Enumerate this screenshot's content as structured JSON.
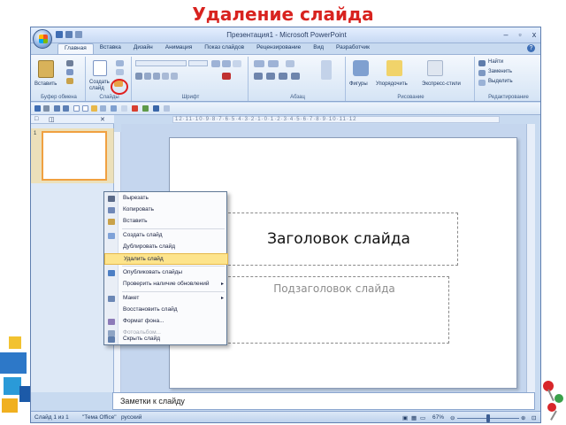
{
  "heading": "Удаление слайда",
  "window": {
    "title": "Презентация1 - Microsoft PowerPoint",
    "controls": [
      "–",
      "▫",
      "x"
    ]
  },
  "ribbon": {
    "tabs": [
      "Главная",
      "Вставка",
      "Дизайн",
      "Анимация",
      "Показ слайдов",
      "Рецензирование",
      "Вид",
      "Разработчик"
    ],
    "groups": {
      "clipboard": {
        "label": "Буфер обмена",
        "paste": "Вставить"
      },
      "slides": {
        "label": "Слайды",
        "new_slide": "Создать слайд"
      },
      "font": {
        "label": "Шрифт"
      },
      "paragraph": {
        "label": "Абзац"
      },
      "drawing": {
        "label": "Рисование",
        "items": [
          "Фигуры",
          "Упорядочить",
          "Экспресс-стили"
        ]
      },
      "editing": {
        "label": "Редактирование",
        "items": [
          "Найти",
          "Заменить",
          "Выделить"
        ]
      }
    }
  },
  "ruler_ticks": "12·11·10·9·8·7·6·5·4·3·2·1·0·1·2·3·4·5·6·7·8·9·10·11·12",
  "slide": {
    "title_placeholder": "Заголовок слайда",
    "subtitle_placeholder": "Подзаголовок слайда"
  },
  "thumb_number": "1",
  "context_menu": [
    {
      "label": "Вырезать",
      "icon_color": "#5a6a88",
      "state": "normal"
    },
    {
      "label": "Копировать",
      "icon_color": "#6f88b8",
      "state": "normal"
    },
    {
      "label": "Вставить",
      "icon_color": "#c9a24a",
      "state": "normal"
    },
    {
      "label": "Создать слайд",
      "icon_color": "#7fa2d8",
      "state": "normal"
    },
    {
      "label": "Дублировать слайд",
      "icon_color": "",
      "state": "normal"
    },
    {
      "label": "Удалить слайд",
      "icon_color": "",
      "state": "highlight"
    },
    {
      "label": "Опубликовать слайды",
      "icon_color": "#4d7fc4",
      "state": "normal"
    },
    {
      "label": "Проверить наличие обновлений",
      "icon_color": "",
      "state": "normal",
      "arrow": "▸"
    },
    {
      "label": "Макет",
      "icon_color": "#6b87b5",
      "state": "normal",
      "arrow": "▸"
    },
    {
      "label": "Восстановить слайд",
      "icon_color": "",
      "state": "normal"
    },
    {
      "label": "Формат фона...",
      "icon_color": "#8c7ab8",
      "state": "normal"
    },
    {
      "label": "Фотоальбом...",
      "icon_color": "#8ea4c4",
      "state": "disabled"
    },
    {
      "label": "Скрыть слайд",
      "icon_color": "#5f7dab",
      "state": "normal"
    }
  ],
  "notes_placeholder": "Заметки к слайду",
  "status": {
    "slide_info": "Слайд 1 из 1",
    "theme": "\"Тема Office\"",
    "language": "русский",
    "zoom": "67%"
  }
}
